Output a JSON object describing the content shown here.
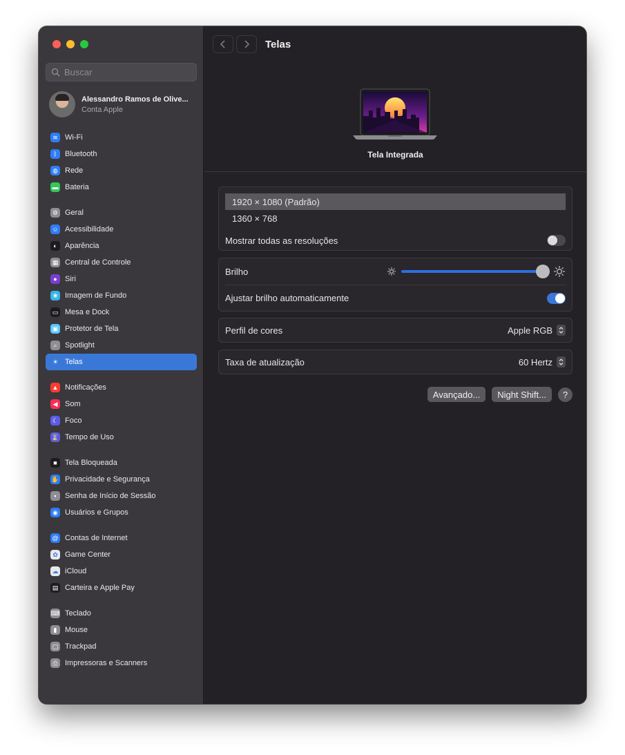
{
  "sidebar": {
    "search": {
      "placeholder": "Buscar"
    },
    "account": {
      "name": "Alessandro Ramos de Olive...",
      "subtitle": "Conta Apple"
    },
    "groups": [
      [
        {
          "label": "Wi-Fi",
          "icon": "wifi-icon",
          "color": "#2f7df6",
          "glyph": "≋"
        },
        {
          "label": "Bluetooth",
          "icon": "bluetooth-icon",
          "color": "#2f7df6",
          "glyph": "ᛒ"
        },
        {
          "label": "Rede",
          "icon": "globe-icon",
          "color": "#2f7df6",
          "glyph": "◍"
        },
        {
          "label": "Bateria",
          "icon": "battery-icon",
          "color": "#34c759",
          "glyph": "▬"
        }
      ],
      [
        {
          "label": "Geral",
          "icon": "gear-icon",
          "color": "#8e8e93",
          "glyph": "⚙"
        },
        {
          "label": "Acessibilidade",
          "icon": "accessibility-icon",
          "color": "#2f7df6",
          "glyph": "☺"
        },
        {
          "label": "Aparência",
          "icon": "appearance-icon",
          "color": "#1c1c1e",
          "glyph": "◐"
        },
        {
          "label": "Central de Controle",
          "icon": "control-center-icon",
          "color": "#8e8e93",
          "glyph": "▦"
        },
        {
          "label": "Siri",
          "icon": "siri-icon",
          "color": "#7a3fd1",
          "glyph": "●"
        },
        {
          "label": "Imagem de Fundo",
          "icon": "wallpaper-icon",
          "color": "#35b6e8",
          "glyph": "❀"
        },
        {
          "label": "Mesa e Dock",
          "icon": "dock-icon",
          "color": "#1c1c1e",
          "glyph": "▭"
        },
        {
          "label": "Protetor de Tela",
          "icon": "screensaver-icon",
          "color": "#5ac8fa",
          "glyph": "▣"
        },
        {
          "label": "Spotlight",
          "icon": "spotlight-icon",
          "color": "#8e8e93",
          "glyph": "⌕"
        },
        {
          "label": "Telas",
          "icon": "display-icon",
          "color": "#2f7df6",
          "glyph": "☀",
          "selected": true
        }
      ],
      [
        {
          "label": "Notificações",
          "icon": "notifications-icon",
          "color": "#ff3b30",
          "glyph": "▲"
        },
        {
          "label": "Som",
          "icon": "sound-icon",
          "color": "#ff2d55",
          "glyph": "◀"
        },
        {
          "label": "Foco",
          "icon": "focus-icon",
          "color": "#5e5ce6",
          "glyph": "☾"
        },
        {
          "label": "Tempo de Uso",
          "icon": "screen-time-icon",
          "color": "#5e5ce6",
          "glyph": "⌛"
        }
      ],
      [
        {
          "label": "Tela Bloqueada",
          "icon": "lock-screen-icon",
          "color": "#1c1c1e",
          "glyph": "■"
        },
        {
          "label": "Privacidade e Segurança",
          "icon": "privacy-hand-icon",
          "color": "#2f7df6",
          "glyph": "✋"
        },
        {
          "label": "Senha de Início de Sessão",
          "icon": "login-password-icon",
          "color": "#8e8e93",
          "glyph": "▪"
        },
        {
          "label": "Usuários e Grupos",
          "icon": "users-groups-icon",
          "color": "#2f7df6",
          "glyph": "◉"
        }
      ],
      [
        {
          "label": "Contas de Internet",
          "icon": "internet-accounts-icon",
          "color": "#2f7df6",
          "glyph": "@"
        },
        {
          "label": "Game Center",
          "icon": "game-center-icon",
          "color": "#e8e8e8",
          "glyph": "✿"
        },
        {
          "label": "iCloud",
          "icon": "icloud-icon",
          "color": "#e8e8e8",
          "glyph": "☁"
        },
        {
          "label": "Carteira e Apple Pay",
          "icon": "wallet-icon",
          "color": "#1c1c1e",
          "glyph": "▤"
        }
      ],
      [
        {
          "label": "Teclado",
          "icon": "keyboard-icon",
          "color": "#8e8e93",
          "glyph": "⌨"
        },
        {
          "label": "Mouse",
          "icon": "mouse-icon",
          "color": "#8e8e93",
          "glyph": "▮"
        },
        {
          "label": "Trackpad",
          "icon": "trackpad-icon",
          "color": "#8e8e93",
          "glyph": "▢"
        },
        {
          "label": "Impressoras e Scanners",
          "icon": "printer-icon",
          "color": "#8e8e93",
          "glyph": "⎙"
        }
      ]
    ]
  },
  "main": {
    "title": "Telas",
    "display_name": "Tela Integrada",
    "resolutions": [
      {
        "label": "1920 × 1080 (Padrão)",
        "selected": true
      },
      {
        "label": "1360 × 768",
        "selected": false
      }
    ],
    "show_all_resolutions": {
      "label": "Mostrar todas as resoluções",
      "on": false
    },
    "brightness": {
      "label": "Brilho",
      "value": 0.96
    },
    "auto_brightness": {
      "label": "Ajustar brilho automaticamente",
      "on": true
    },
    "color_profile": {
      "label": "Perfil de cores",
      "value": "Apple RGB"
    },
    "refresh_rate": {
      "label": "Taxa de atualização",
      "value": "60 Hertz"
    },
    "buttons": {
      "advanced": "Avançado...",
      "night_shift": "Night Shift...",
      "help": "?"
    }
  },
  "colors": {
    "accent": "#3a78d8",
    "sidebar_bg": "#3a383c",
    "main_bg": "#232125"
  }
}
